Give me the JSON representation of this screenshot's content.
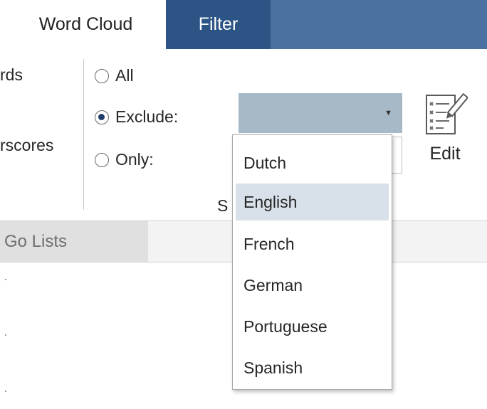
{
  "tabs": {
    "word_cloud": "Word Cloud",
    "filter": "Filter"
  },
  "ribbon": {
    "left_cut": {
      "words": "rds",
      "underscores": "rscores"
    },
    "stopwords": {
      "all_label": "All",
      "exclude_label": "Exclude:",
      "only_label": "Only:",
      "selected": "exclude",
      "combo_value": "",
      "group_label_partial": "S"
    },
    "edit": {
      "label": "Edit",
      "icon": "edit-list-icon"
    }
  },
  "lower": {
    "tab_label": "Go Lists"
  },
  "dropdown": {
    "options": [
      "Dutch",
      "English",
      "French",
      "German",
      "Portuguese",
      "Spanish"
    ],
    "highlighted": "English"
  },
  "colors": {
    "tab_blue": "#4a72a0",
    "tab_active": "#2c5585",
    "combo_bg": "#a7b8c7",
    "highlight": "#d8e0e9"
  }
}
